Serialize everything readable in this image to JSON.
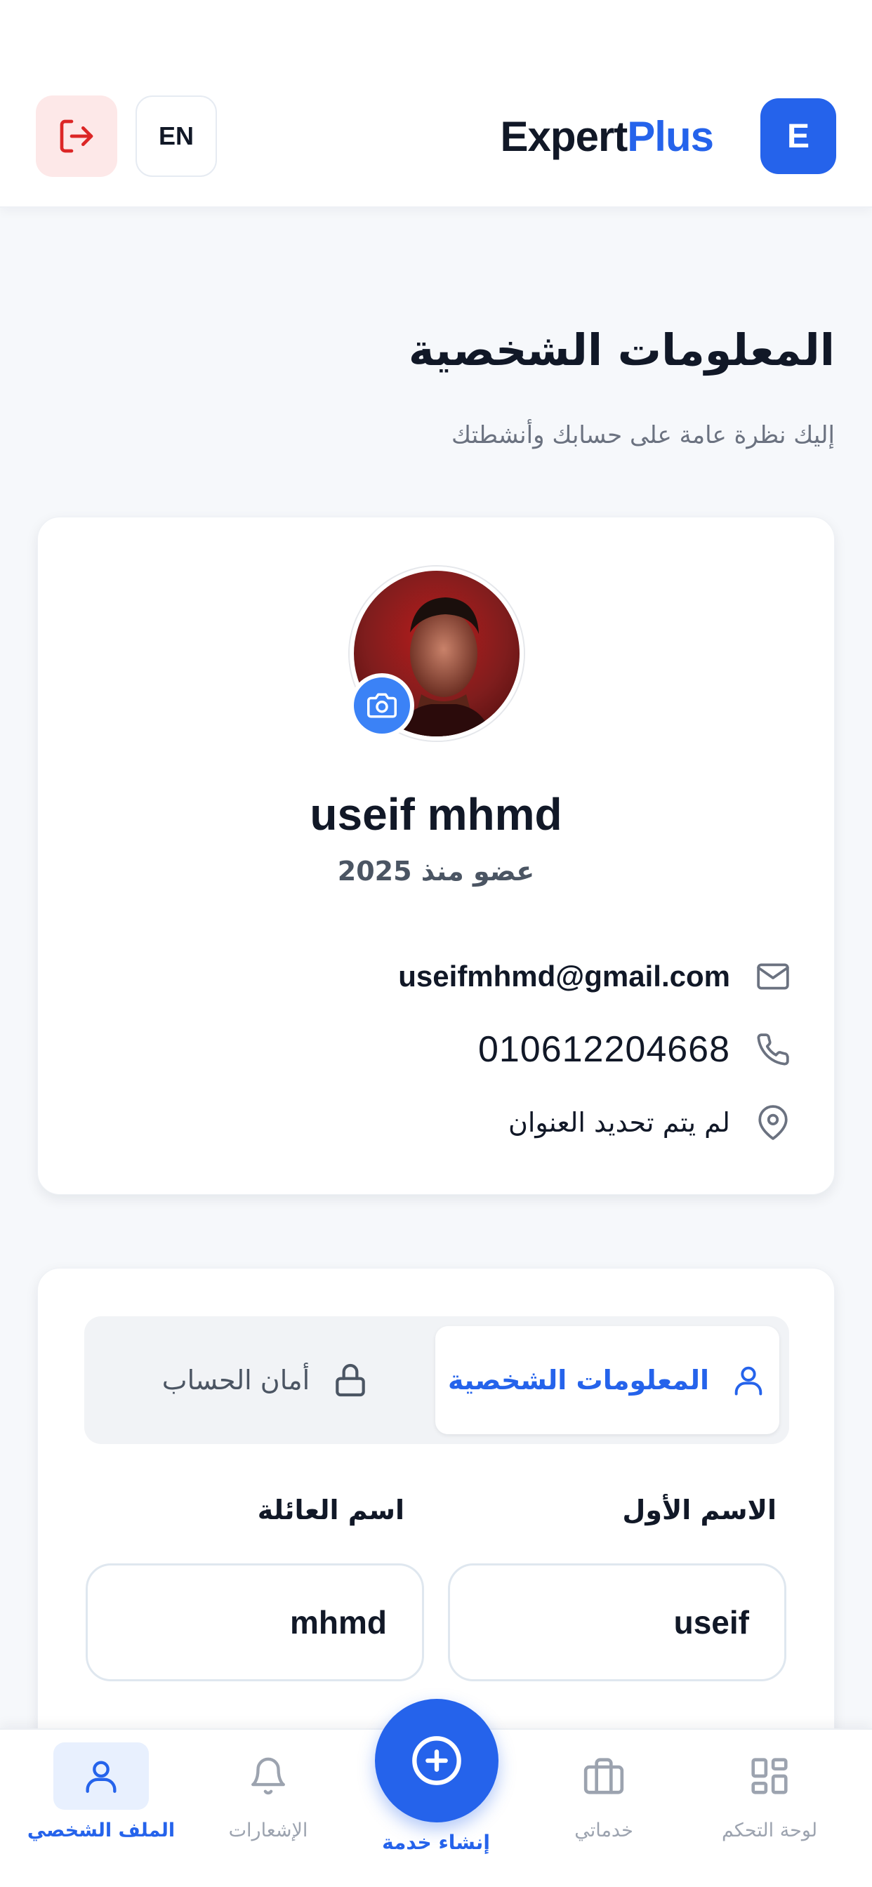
{
  "header": {
    "lang_label": "EN",
    "brand_part1": "Expert",
    "brand_part2": "Plus",
    "brand_badge": "E"
  },
  "page": {
    "title": "المعلومات الشخصية",
    "subtitle": "إليك نظرة عامة على حسابك وأنشطتك"
  },
  "profile": {
    "name": "useif mhmd",
    "member_since": "عضو منذ 2025",
    "email": "useifmhmd@gmail.com",
    "phone": "010612204668",
    "address": "لم يتم تحديد العنوان"
  },
  "tabs": {
    "personal_info": "المعلومات الشخصية",
    "account_security": "أمان الحساب"
  },
  "form": {
    "first_name_label": "الاسم الأول",
    "first_name_value": "useif",
    "last_name_label": "اسم العائلة",
    "last_name_value": "mhmd"
  },
  "bottom_nav": {
    "profile": "الملف الشخصي",
    "notifications": "الإشعارات",
    "create_service": "إنشاء خدمة",
    "my_services": "خدماتي",
    "dashboard": "لوحة التحكم"
  },
  "colors": {
    "primary": "#2563eb",
    "logout_bg": "#fde8e8",
    "logout_icon": "#dc2626"
  }
}
